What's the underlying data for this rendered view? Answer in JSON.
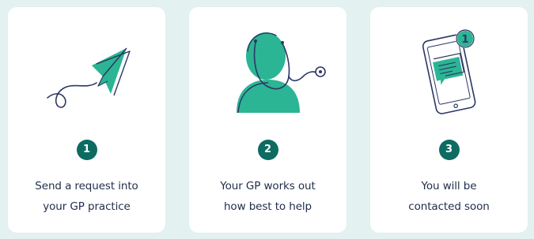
{
  "colors": {
    "background": "#e3f2f0",
    "card": "#ffffff",
    "accent_teal": "#2bb594",
    "badge_green": "#0d6b62",
    "ink_navy": "#2c3763",
    "text": "#1f2d49"
  },
  "steps": [
    {
      "icon": "paper-plane-icon",
      "number": "1",
      "line1": "Send a request into",
      "line2": "your GP practice"
    },
    {
      "icon": "doctor-stethoscope-icon",
      "number": "2",
      "line1": "Your GP works out",
      "line2": "how best to help"
    },
    {
      "icon": "phone-message-icon",
      "number": "3",
      "line1": "You will be",
      "line2": "contacted soon",
      "notification_count": "1"
    }
  ]
}
